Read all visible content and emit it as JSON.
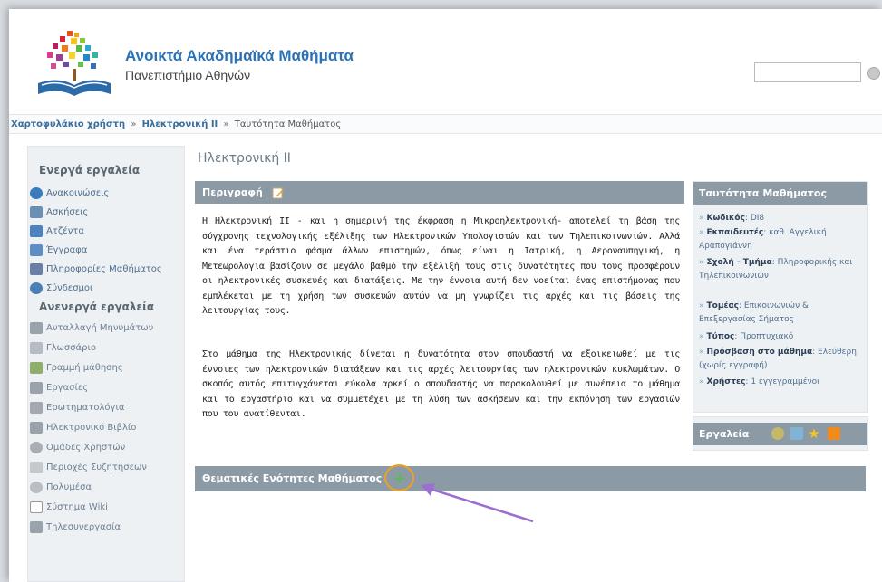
{
  "header": {
    "title": "Ανοικτά Ακαδημαϊκά Μαθήματα",
    "subtitle": "Πανεπιστήμιο Αθηνών",
    "search_placeholder": ""
  },
  "breadcrumb": {
    "items": [
      "Χαρτοφυλάκιο χρήστη",
      "Ηλεκτρονική ΙΙ",
      "Ταυτότητα Μαθήματος"
    ],
    "separator": "»"
  },
  "sidebar": {
    "active_heading": "Ενεργά εργαλεία",
    "active_items": [
      {
        "label": "Ανακοινώσεις",
        "icon": "announcements-icon",
        "color": "#3a7bbf"
      },
      {
        "label": "Ασκήσεις",
        "icon": "exercises-icon",
        "color": "#6a8fb5"
      },
      {
        "label": "Ατζέντα",
        "icon": "calendar-icon",
        "color": "#4a82c0"
      },
      {
        "label": "Έγγραφα",
        "icon": "documents-icon",
        "color": "#5f8ec4"
      },
      {
        "label": "Πληροφορίες Μαθήματος",
        "icon": "info-icon",
        "color": "#6a7fa5"
      },
      {
        "label": "Σύνδεσμοι",
        "icon": "links-icon",
        "color": "#4a7fb5"
      }
    ],
    "inactive_heading": "Ανενεργά εργαλεία",
    "inactive_items": [
      {
        "label": "Ανταλλαγή Μηνυμάτων",
        "icon": "messages-icon",
        "color": "#9aa3ab"
      },
      {
        "label": "Γλωσσάριο",
        "icon": "glossary-icon",
        "color": "#9aa3ab"
      },
      {
        "label": "Γραμμή μάθησης",
        "icon": "learning-path-icon",
        "color": "#8fae6a"
      },
      {
        "label": "Εργασίες",
        "icon": "assignments-icon",
        "color": "#9aa3ab"
      },
      {
        "label": "Ερωτηματολόγια",
        "icon": "questionnaire-icon",
        "color": "#9aa3ab"
      },
      {
        "label": "Ηλεκτρονικό Βιβλίο",
        "icon": "ebook-icon",
        "color": "#9aa3ab"
      },
      {
        "label": "Ομάδες Χρηστών",
        "icon": "groups-icon",
        "color": "#9aa3ab"
      },
      {
        "label": "Περιοχές Συζητήσεων",
        "icon": "forum-icon",
        "color": "#9aa3ab"
      },
      {
        "label": "Πολυμέσα",
        "icon": "multimedia-icon",
        "color": "#9aa3ab"
      },
      {
        "label": "Σύστημα Wiki",
        "icon": "wiki-icon",
        "color": "#9aa3ab"
      },
      {
        "label": "Τηλεσυνεργασία",
        "icon": "teleconference-icon",
        "color": "#9aa3ab"
      }
    ]
  },
  "main": {
    "course_title": "Ηλεκτρονική ΙΙ",
    "description_label": "Περιγραφή",
    "paragraph1": "Η Ηλεκτρονική ΙΙ - και η σημερινή της έκφραση η Μικροηλεκτρονική- αποτελεί τη βάση της σύγχρονης τεχνολογικής εξέλιξης των Ηλεκτρονικών Υπολογιστών και των Τηλεπικοινωνιών. Αλλά και ένα τεράστιο φάσμα άλλων επιστημών, όπως είναι η Ιατρική, η Αεροναυπηγική, η Μετεωρολογία βασίζουν σε μεγάλο βαθμό την εξέλιξή τους στις δυνατότητες που τους προσφέρουν οι ηλεκτρονικές συσκευές και διατάξεις. Με την έννοια αυτή δεν νοείται ένας επιστήμονας που εμπλέκεται με τη χρήση των συσκευών αυτών να μη γνωρίζει τις αρχές και τις βάσεις της λειτουργίας τους.",
    "paragraph2": "Στο μάθημα της Ηλεκτρονικής δίνεται η δυνατότητα στον σπουδαστή να εξοικειωθεί με τις έννοιες των ηλεκτρονικών διατάξεων και τις αρχές λειτουργίας των ηλεκτρονικών κυκλωμάτων. Ο σκοπός αυτός επιτυγχάνεται εύκολα αρκεί ο σπουδαστής να παρακολουθεί με συνέπεια το μάθημα και το εργαστήριο και να συμμετέχει με τη λύση των ασκήσεων και την εκπόνηση των εργασιών που του ανατίθενται.",
    "units_label": "Θεματικές Ενότητες Μαθήματος",
    "add_symbol": "+"
  },
  "info": {
    "heading": "Ταυτότητα Μαθήματος",
    "code_label": "Κωδικός",
    "code_value": "DI8",
    "instructors_label": "Εκπαιδευτές",
    "instructors_value": "καθ. Αγγελική Αραπογιάννη",
    "school_label": "Σχολή - Τμήμα",
    "school_value": "Πληροφορικής και Τηλεπικοινωνιών",
    "sector_label": "Τομέας",
    "sector_value": "Επικοινωνιών & Επεξεργασίας Σήματος",
    "type_label": "Τύπος",
    "type_value": "Προπτυχιακό",
    "access_label": "Πρόσβαση στο μάθημα",
    "access_value": "Ελεύθερη (χωρίς εγγραφή)",
    "users_label": "Χρήστες",
    "users_value": "1 εγγεγραμμένοι"
  },
  "tools": {
    "heading": "Εργαλεία",
    "icons": [
      "users-icon",
      "export-icon",
      "favorite-icon",
      "rss-icon"
    ]
  },
  "colors": {
    "bar": "#8c9aa6",
    "title_blue": "#2a72b8",
    "highlight": "#f0a020",
    "arrow": "#9a6fd0"
  }
}
